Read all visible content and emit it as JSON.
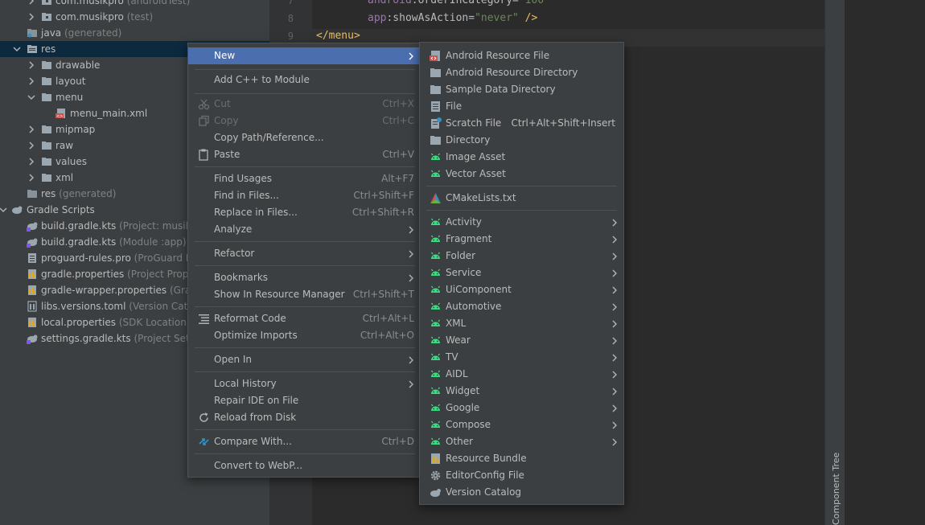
{
  "tree": {
    "rows": [
      {
        "name": "com.musikpro",
        "extra": "(androidTest)"
      },
      {
        "name": "com.musikpro",
        "extra": "(test)"
      },
      {
        "name": "java",
        "extra": "(generated)"
      },
      {
        "name": "res",
        "extra": ""
      },
      {
        "name": "drawable",
        "extra": ""
      },
      {
        "name": "layout",
        "extra": ""
      },
      {
        "name": "menu",
        "extra": ""
      },
      {
        "name": "menu_main.xml",
        "extra": ""
      },
      {
        "name": "mipmap",
        "extra": ""
      },
      {
        "name": "raw",
        "extra": ""
      },
      {
        "name": "values",
        "extra": ""
      },
      {
        "name": "xml",
        "extra": ""
      },
      {
        "name": "res",
        "extra": "(generated)"
      },
      {
        "name": "Gradle Scripts",
        "extra": ""
      },
      {
        "name": "build.gradle.kts",
        "extra": "(Project: musikpro)"
      },
      {
        "name": "build.gradle.kts",
        "extra": "(Module :app)"
      },
      {
        "name": "proguard-rules.pro",
        "extra": "(ProGuard Rules"
      },
      {
        "name": "gradle.properties",
        "extra": "(Project Properties"
      },
      {
        "name": "gradle-wrapper.properties",
        "extra": "(Gradle"
      },
      {
        "name": "libs.versions.toml",
        "extra": "(Version Catalog"
      },
      {
        "name": "local.properties",
        "extra": "(SDK Location)"
      },
      {
        "name": "settings.gradle.kts",
        "extra": "(Project Settings"
      }
    ]
  },
  "editor": {
    "lines": [
      {
        "num": "7",
        "ns": "android",
        "attr": ":orderInCategory",
        "eq": "=",
        "val": "\"100\"",
        "end": ""
      },
      {
        "num": "8",
        "ns": "app",
        "attr": ":showAsAction",
        "eq": "=",
        "val": "\"never\"",
        "end": " />"
      },
      {
        "num": "9",
        "tag": "</menu>"
      }
    ]
  },
  "right_panel": {
    "label": "Component Tree"
  },
  "context_menu": {
    "items": [
      {
        "label": "New",
        "shortcut": "",
        "submenu": true
      },
      {
        "label": "Add C++ to Module",
        "shortcut": ""
      },
      {
        "label": "Cut",
        "shortcut": "Ctrl+X",
        "disabled": true
      },
      {
        "label": "Copy",
        "shortcut": "Ctrl+C",
        "disabled": true
      },
      {
        "label": "Copy Path/Reference...",
        "shortcut": ""
      },
      {
        "label": "Paste",
        "shortcut": "Ctrl+V"
      },
      {
        "label": "Find Usages",
        "shortcut": "Alt+F7"
      },
      {
        "label": "Find in Files...",
        "shortcut": "Ctrl+Shift+F"
      },
      {
        "label": "Replace in Files...",
        "shortcut": "Ctrl+Shift+R"
      },
      {
        "label": "Analyze",
        "shortcut": "",
        "submenu": true
      },
      {
        "label": "Refactor",
        "shortcut": "",
        "submenu": true
      },
      {
        "label": "Bookmarks",
        "shortcut": "",
        "submenu": true
      },
      {
        "label": "Show In Resource Manager",
        "shortcut": "Ctrl+Shift+T"
      },
      {
        "label": "Reformat Code",
        "shortcut": "Ctrl+Alt+L"
      },
      {
        "label": "Optimize Imports",
        "shortcut": "Ctrl+Alt+O"
      },
      {
        "label": "Open In",
        "shortcut": "",
        "submenu": true
      },
      {
        "label": "Local History",
        "shortcut": "",
        "submenu": true
      },
      {
        "label": "Repair IDE on File",
        "shortcut": ""
      },
      {
        "label": "Reload from Disk",
        "shortcut": ""
      },
      {
        "label": "Compare With...",
        "shortcut": "Ctrl+D"
      },
      {
        "label": "Convert to WebP...",
        "shortcut": ""
      }
    ]
  },
  "new_submenu": {
    "items": [
      {
        "label": "Android Resource File",
        "shortcut": ""
      },
      {
        "label": "Android Resource Directory",
        "shortcut": ""
      },
      {
        "label": "Sample Data Directory",
        "shortcut": ""
      },
      {
        "label": "File",
        "shortcut": ""
      },
      {
        "label": "Scratch File",
        "shortcut": "Ctrl+Alt+Shift+Insert"
      },
      {
        "label": "Directory",
        "shortcut": ""
      },
      {
        "label": "Image Asset",
        "shortcut": ""
      },
      {
        "label": "Vector Asset",
        "shortcut": ""
      },
      {
        "label": "CMakeLists.txt",
        "shortcut": ""
      },
      {
        "label": "Activity",
        "submenu": true
      },
      {
        "label": "Fragment",
        "submenu": true
      },
      {
        "label": "Folder",
        "submenu": true
      },
      {
        "label": "Service",
        "submenu": true
      },
      {
        "label": "UiComponent",
        "submenu": true
      },
      {
        "label": "Automotive",
        "submenu": true
      },
      {
        "label": "XML",
        "submenu": true
      },
      {
        "label": "Wear",
        "submenu": true
      },
      {
        "label": "TV",
        "submenu": true
      },
      {
        "label": "AIDL",
        "submenu": true
      },
      {
        "label": "Widget",
        "submenu": true
      },
      {
        "label": "Google",
        "submenu": true
      },
      {
        "label": "Compose",
        "submenu": true
      },
      {
        "label": "Other",
        "submenu": true
      },
      {
        "label": "Resource Bundle",
        "shortcut": ""
      },
      {
        "label": "EditorConfig File",
        "shortcut": ""
      },
      {
        "label": "Version Catalog",
        "shortcut": ""
      }
    ]
  },
  "colors": {
    "selection": "#4b6eaf",
    "android_green": "#3ddc84",
    "panel": "#3c3f41",
    "editor": "#2b2b2b"
  }
}
